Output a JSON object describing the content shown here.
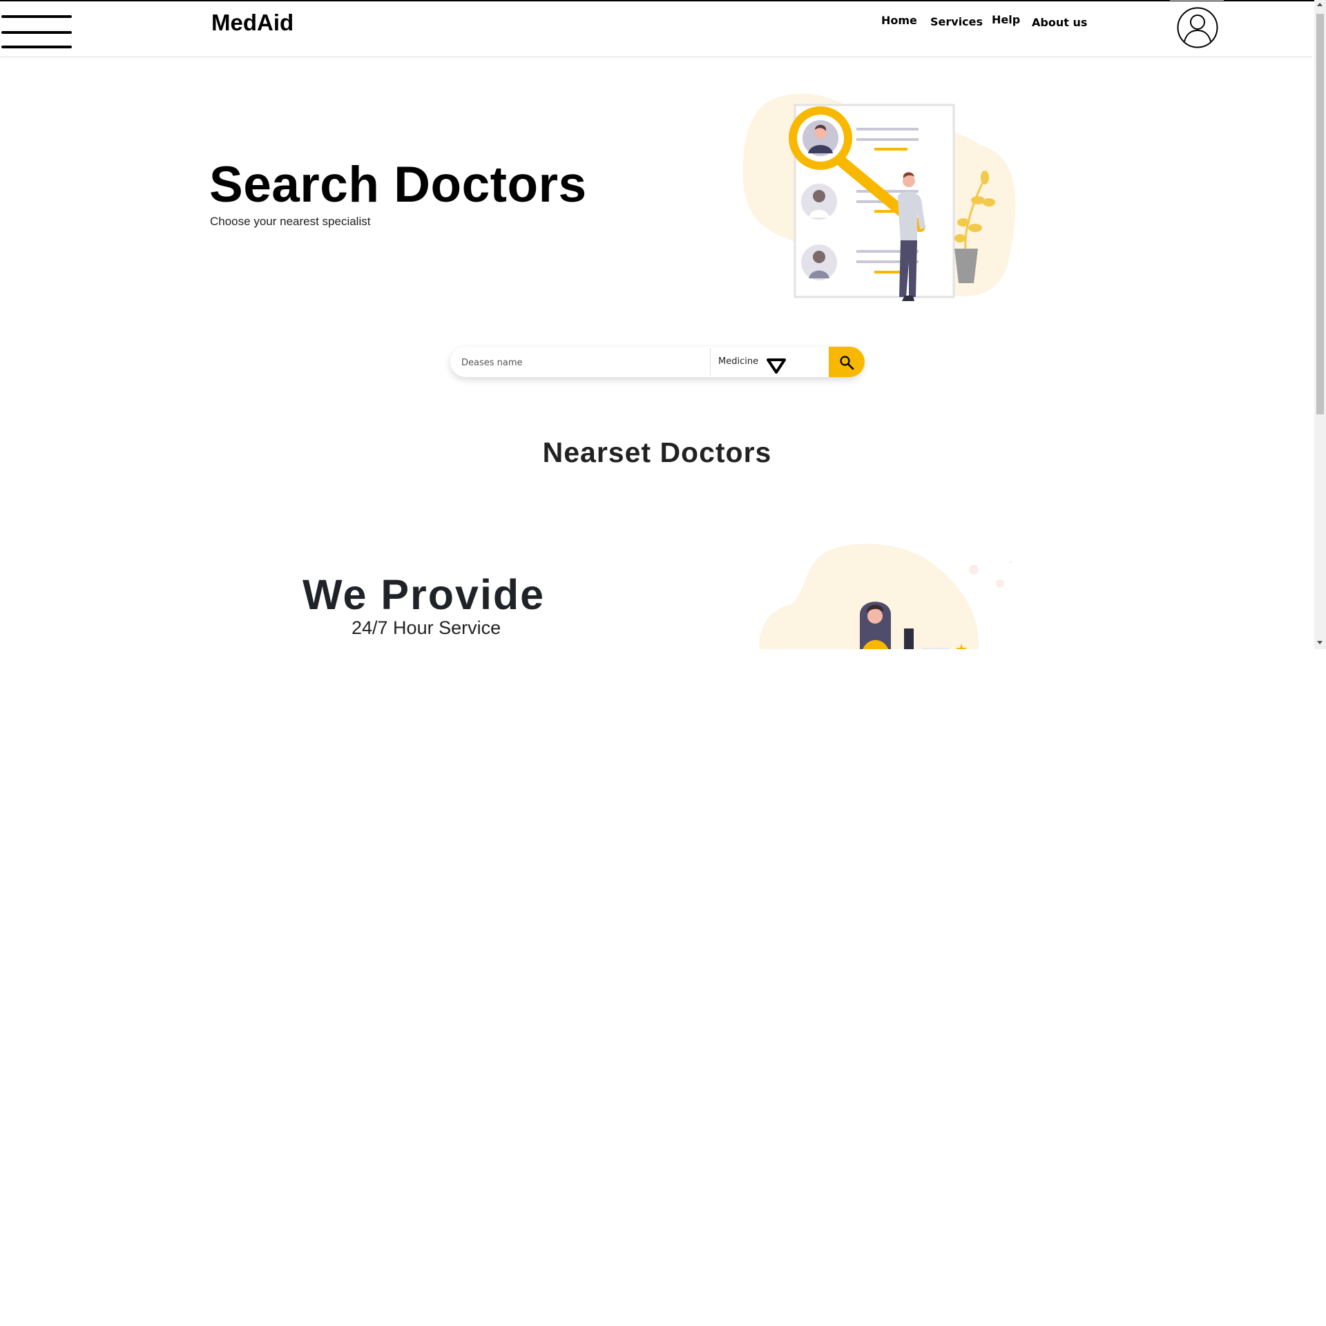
{
  "navbar": {
    "brand": "MedAid",
    "links": [
      "Home",
      "Services",
      "Help",
      "About us"
    ],
    "menu_icon": "hamburger-menu-icon",
    "profile_icon": "user-avatar-icon"
  },
  "hero": {
    "title": "Search Doctors",
    "subtitle": "Choose your nearest specialist",
    "illustration": "doctor-search-illustration"
  },
  "search": {
    "placeholder": "Deases name",
    "category_selected": "Medicine",
    "category_icon": "triangle-down-icon",
    "button_icon": "search-icon"
  },
  "nearest": {
    "title": "Nearset Doctors"
  },
  "provide": {
    "title": "We Provide",
    "subtitle": "24/7 Hour Service",
    "illustration": "support-agent-illustration"
  },
  "colors": {
    "accent": "#f9b800",
    "text": "#000000",
    "blob": "#fdf4e1",
    "figure": "#4f4d6b"
  }
}
